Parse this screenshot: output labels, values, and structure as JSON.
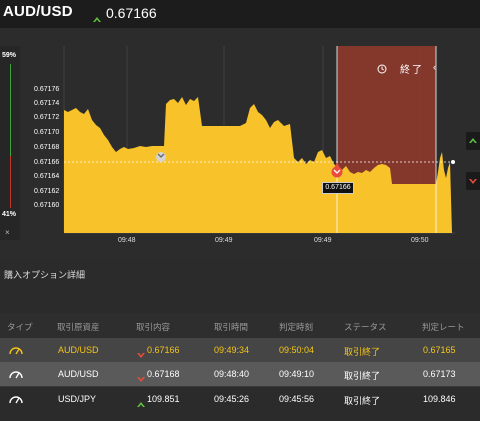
{
  "header": {
    "pair": "AUD/USD",
    "rate": "0.67166",
    "trend": "up",
    "up_color": "#5fbf3f",
    "down_color": "#e74c3c"
  },
  "side": {
    "high_pct": "59%",
    "low_pct": "41%",
    "close_symbol": "×"
  },
  "chart_data": {
    "type": "area",
    "y_ticks": [
      "0.67176",
      "0.67174",
      "0.67172",
      "0.67170",
      "0.67168",
      "0.67166",
      "0.67164",
      "0.67162",
      "0.67160"
    ],
    "x_ticks": [
      "09:48",
      "09:49",
      "09:49",
      "09:50"
    ],
    "current_price": "0.67166",
    "close_label": "終了",
    "fill_color": "#f7c22a",
    "close_zone_color": "#8b3a2b"
  },
  "section": {
    "title": "購入オプション詳細"
  },
  "table": {
    "headers": [
      "タイプ",
      "取引原資産",
      "取引内容",
      "取引時間",
      "判定時刻",
      "ステータス",
      "判定レート"
    ],
    "rows": [
      {
        "asset": "AUD/USD",
        "direction": "down",
        "entry": "0.67166",
        "time": "09:49:34",
        "expiry": "09:50:04",
        "status": "取引終了",
        "result": "0.67165"
      },
      {
        "asset": "AUD/USD",
        "direction": "down",
        "entry": "0.67168",
        "time": "09:48:40",
        "expiry": "09:49:10",
        "status": "取引終了",
        "result": "0.67173"
      },
      {
        "asset": "USD/JPY",
        "direction": "up",
        "entry": "109.851",
        "time": "09:45:26",
        "expiry": "09:45:56",
        "status": "取引終了",
        "result": "109.846"
      }
    ]
  }
}
